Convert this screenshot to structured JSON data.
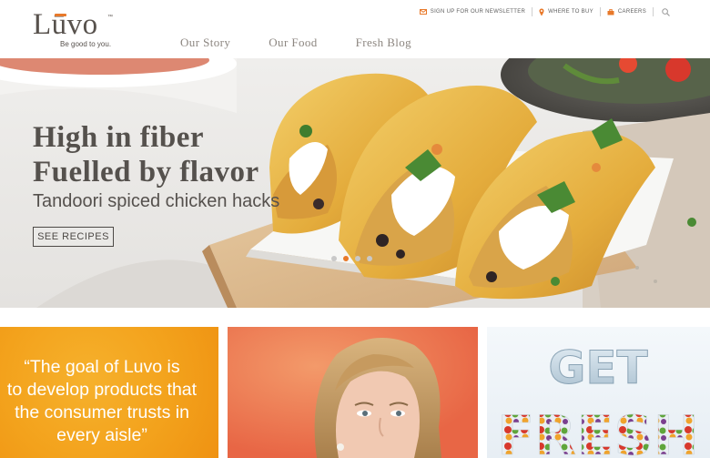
{
  "brand": {
    "name": "Lūvo",
    "trademark": "™",
    "tagline": "Be good to you."
  },
  "utility_nav": [
    {
      "label": "SIGN UP FOR OUR NEWSLETTER",
      "icon": "envelope-icon"
    },
    {
      "label": "WHERE TO BUY",
      "icon": "map-pin-icon"
    },
    {
      "label": "CAREERS",
      "icon": "briefcase-icon"
    }
  ],
  "main_nav": [
    {
      "label": "Our Story"
    },
    {
      "label": "Our Food"
    },
    {
      "label": "Fresh Blog"
    }
  ],
  "hero": {
    "headline_line1": "High in fiber",
    "headline_line2": "Fuelled by flavor",
    "subheadline": "Tandoori spiced chicken hacks",
    "cta": "SEE RECIPES",
    "slide_count": 4,
    "active_slide": 2
  },
  "tiles": {
    "quote": {
      "lines": [
        "“The goal of Luvo is",
        "to develop products that",
        "the consumer trusts in",
        "every aisle”"
      ]
    },
    "fresh": {
      "word1": "GET",
      "word2": "FRESH"
    }
  },
  "colors": {
    "accent": "#e8792a",
    "brand_text": "#58524d",
    "quote_tile": "#f3a21c"
  }
}
